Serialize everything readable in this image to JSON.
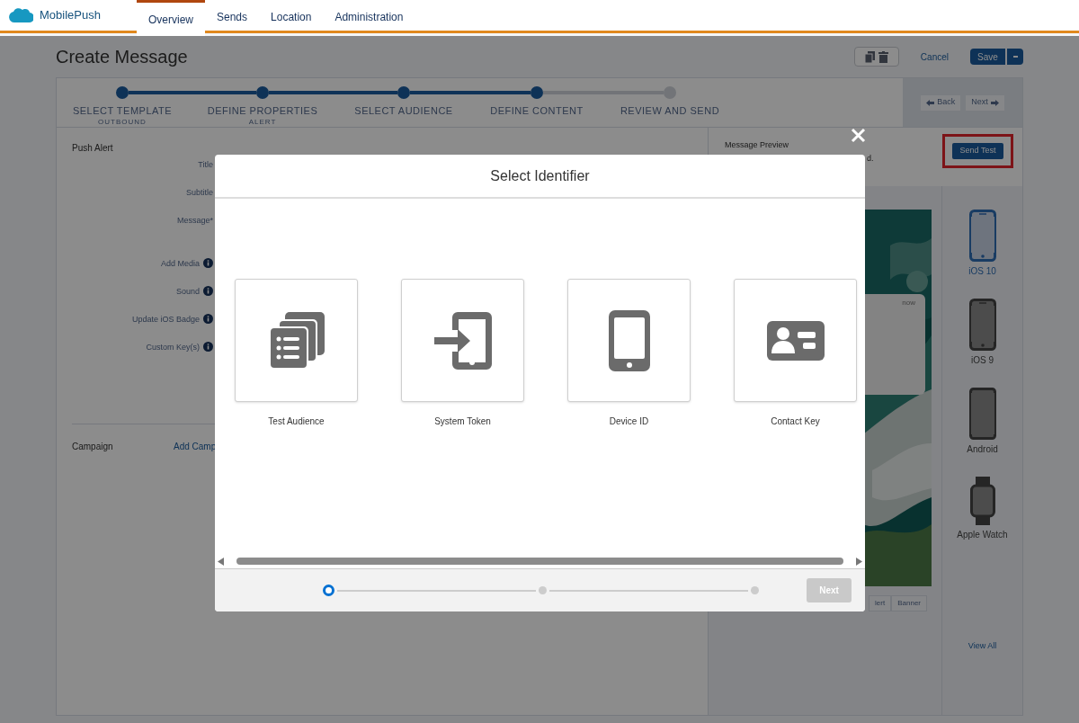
{
  "app": {
    "name": "MobilePush"
  },
  "nav_tabs": [
    {
      "label": "Overview",
      "selected": true
    },
    {
      "label": "Sends",
      "selected": false
    },
    {
      "label": "Location",
      "selected": false
    },
    {
      "label": "Administration",
      "selected": false
    }
  ],
  "page": {
    "title": "Create Message",
    "cancel": "Cancel",
    "save": "Save"
  },
  "stepper": {
    "steps": [
      {
        "label": "SELECT TEMPLATE",
        "sublabel": "OUTBOUND",
        "done": true
      },
      {
        "label": "DEFINE PROPERTIES",
        "sublabel": "ALERT",
        "done": true
      },
      {
        "label": "SELECT AUDIENCE",
        "done": true
      },
      {
        "label": "DEFINE CONTENT",
        "done": true
      },
      {
        "label": "REVIEW AND SEND",
        "done": false
      }
    ],
    "back": "Back",
    "next": "Next"
  },
  "form": {
    "section": "Push Alert",
    "fields": [
      {
        "label": "Title",
        "kind": "text"
      },
      {
        "label": "Subtitle",
        "kind": "text"
      },
      {
        "label": "Message*",
        "kind": "textarea"
      },
      {
        "label": "Add Media",
        "kind": "option"
      },
      {
        "label": "Sound",
        "kind": "option"
      },
      {
        "label": "Update iOS Badge",
        "kind": "option"
      },
      {
        "label": "Custom Key(s)",
        "kind": "option"
      }
    ],
    "campaign_label": "Campaign",
    "campaign_link": "Add Camp"
  },
  "preview": {
    "title": "Message Preview",
    "notice": "d.",
    "send_test": "Send Test",
    "notification_time": "now",
    "tabs": [
      {
        "label": "lert",
        "selected": false
      },
      {
        "label": "Banner",
        "selected": false
      }
    ],
    "devices": [
      {
        "label": "iOS 10",
        "kind": "phone",
        "selected": true
      },
      {
        "label": "iOS 9",
        "kind": "phone",
        "selected": false
      },
      {
        "label": "Android",
        "kind": "android",
        "selected": false
      },
      {
        "label": "Apple Watch",
        "kind": "watch",
        "selected": false
      }
    ],
    "view_all": "View All"
  },
  "dialog": {
    "title": "Select Identifier",
    "options": [
      {
        "label": "Test Audience",
        "kind": "list"
      },
      {
        "label": "System Token",
        "kind": "token"
      },
      {
        "label": "Device ID",
        "kind": "device"
      },
      {
        "label": "Contact Key",
        "kind": "contact"
      }
    ],
    "steps": [
      {
        "selected": true
      },
      {
        "selected": false
      },
      {
        "selected": false
      }
    ],
    "next": {
      "label": "Next",
      "disabled": true
    }
  }
}
